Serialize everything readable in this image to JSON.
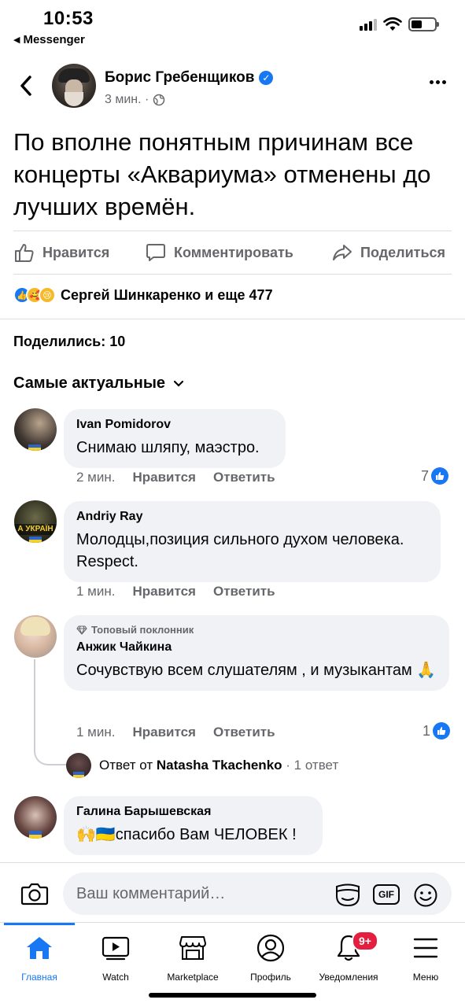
{
  "status": {
    "time": "10:53",
    "back_app": "Messenger"
  },
  "post": {
    "author": "Борис Гребенщиков",
    "time": "3 мин. ·",
    "text": "По вполне понятным причинам все концерты «Аквариума» отменены до лучших времён."
  },
  "actions": {
    "like": "Нравится",
    "comment": "Комментировать",
    "share": "Поделиться"
  },
  "reactions_summary": "Сергей Шинкаренко и еще 477",
  "shares": "Поделились: 10",
  "sort_label": "Самые актуальные",
  "comments": [
    {
      "name": "Ivan Pomidorov",
      "text": "Снимаю шляпу, маэстро.",
      "time": "2 мин.",
      "like": "Нравится",
      "reply": "Ответить",
      "likes": "7"
    },
    {
      "name": "Andriy Ray",
      "text": "Молодцы,позиция сильного духом человека. Respect.",
      "time": "1 мин.",
      "like": "Нравится",
      "reply": "Ответить",
      "avatar_tag": "А УКРАЇН"
    },
    {
      "badge": "Топовый поклонник",
      "name": "Анжик Чайкина",
      "text": "Сочувствую всем слушателям , и музыкантам 🙏",
      "time": "1 мин.",
      "like": "Нравится",
      "reply": "Ответить",
      "likes": "1"
    },
    {
      "name": "Галина Барышевская",
      "text": "🙌🇺🇦спасибо Вам ЧЕЛОВЕК !"
    }
  ],
  "reply_thread": {
    "prefix": "Ответ от",
    "author": "Natasha Tkachenko",
    "count": "· 1 ответ"
  },
  "composer": {
    "placeholder": "Ваш комментарий…",
    "gif": "GIF"
  },
  "nav": {
    "home": "Главная",
    "watch": "Watch",
    "marketplace": "Marketplace",
    "profile": "Профиль",
    "notifications": "Уведомления",
    "notifications_badge": "9+",
    "menu": "Меню"
  },
  "colors": {
    "accent": "#1877f2",
    "badge": "#e41e3f",
    "bubble": "#f0f2f5",
    "secondary_text": "#65676b"
  }
}
